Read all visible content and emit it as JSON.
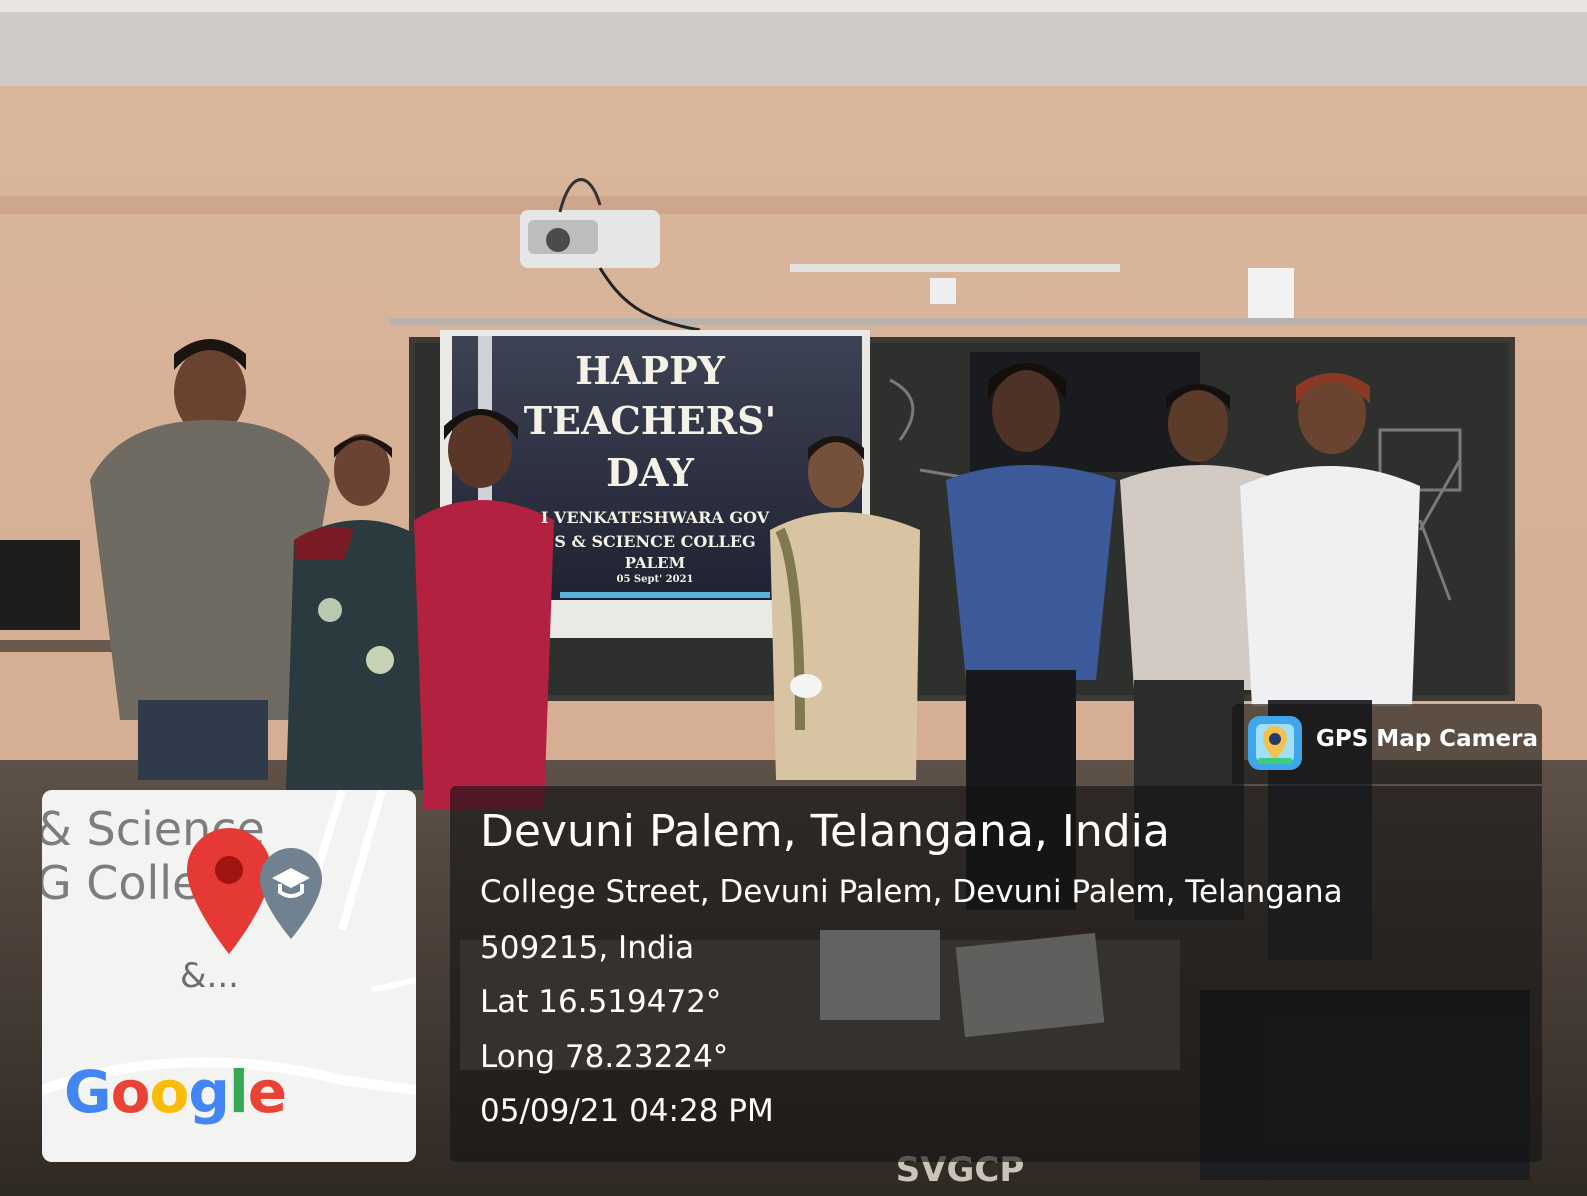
{
  "photo": {
    "screen": {
      "line1": "HAPPY",
      "line2": "TEACHERS'",
      "line3": "DAY",
      "line4": "I VENKATESHWARA GOV",
      "line5": "S & SCIENCE COLLEG",
      "line6": "PALEM",
      "line7": "05 Sept' 2021"
    },
    "bench_text": "SVGCP"
  },
  "gps_badge": {
    "app_name": "GPS Map Camera",
    "icon": "camera-pin-icon"
  },
  "gps_info": {
    "place": "Devuni Palem, Telangana, India",
    "address_line1": "College Street, Devuni Palem, Devuni Palem, Telangana",
    "address_line2": "509215, India",
    "lat": "Lat 16.519472°",
    "long": "Long 78.23224°",
    "datetime": "05/09/21 04:28 PM"
  },
  "map": {
    "label1": "& Science",
    "label2": "G College",
    "label3": "&...",
    "logo": "Google",
    "logo_colors": [
      "#4285F4",
      "#EA4335",
      "#FBBC05",
      "#4285F4",
      "#34A853",
      "#EA4335"
    ],
    "pin_color": "#EA4335",
    "poi_icon": "graduation-cap-icon"
  }
}
